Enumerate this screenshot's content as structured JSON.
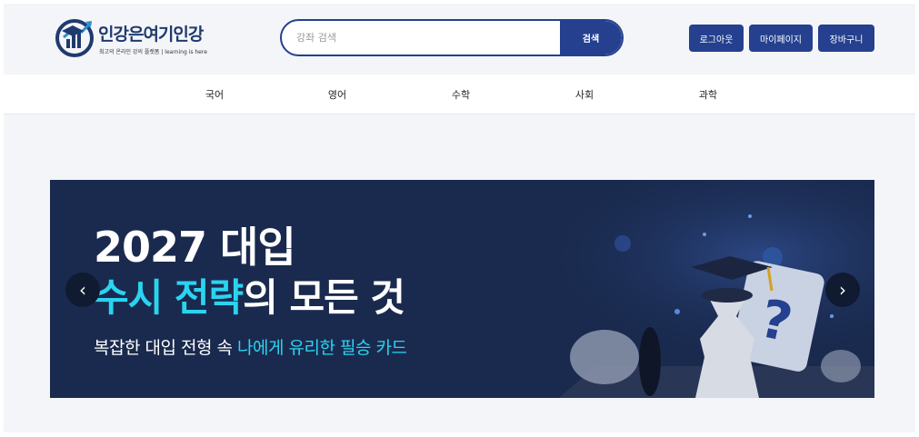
{
  "logo": {
    "title": "인강은여기인강",
    "tagline": "최고의 온라인 강의 플랫폼 | learning is here",
    "icon": "graduation-chart-icon"
  },
  "search": {
    "placeholder": "강좌 검색",
    "value": "",
    "button_label": "검색"
  },
  "header_buttons": {
    "logout": "로그아웃",
    "mypage": "마이페이지",
    "cart": "장바구니"
  },
  "nav": {
    "items": [
      "국어",
      "영어",
      "수학",
      "사회",
      "과학"
    ]
  },
  "banner": {
    "line1": "2027 대입",
    "line2_highlight": "수시 전략",
    "line2_rest": "의 모든 것",
    "line3_prefix": "복잡한 대입 전형 속 ",
    "line3_highlight": "나에게 유리한 필승 카드",
    "prev_icon": "‹",
    "next_icon": "›"
  },
  "colors": {
    "brand": "#24408e",
    "banner_bg": "#1a2a4e",
    "highlight": "#2ad4f0"
  }
}
